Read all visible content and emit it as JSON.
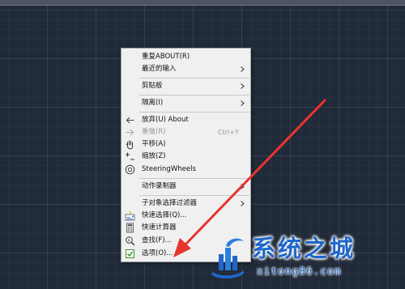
{
  "context_menu": {
    "items": [
      {
        "label": "重复ABOUT(R)"
      },
      {
        "label": "最近的输入"
      },
      {
        "label": "剪贴板"
      },
      {
        "label": "隔离(I)"
      },
      {
        "label": "放弃(U) About"
      },
      {
        "label": "重做(R)",
        "shortcut": "Ctrl+Y",
        "disabled": true
      },
      {
        "label": "平移(A)"
      },
      {
        "label": "缩放(Z)"
      },
      {
        "label": "SteeringWheels"
      },
      {
        "label": "动作录制器"
      },
      {
        "label": "子对象选择过滤器"
      },
      {
        "label": "快速选择(Q)..."
      },
      {
        "label": "快速计算器"
      },
      {
        "label": "查找(F)..."
      },
      {
        "label": "选项(O)..."
      }
    ]
  },
  "watermark": {
    "title": "系统之城",
    "url": "xitong86.com"
  },
  "colors": {
    "canvas_bg": "#212a38",
    "menu_bg": "#f0f0f0",
    "annotation_arrow": "#e8342e",
    "watermark_blue": "#1f67c9"
  }
}
